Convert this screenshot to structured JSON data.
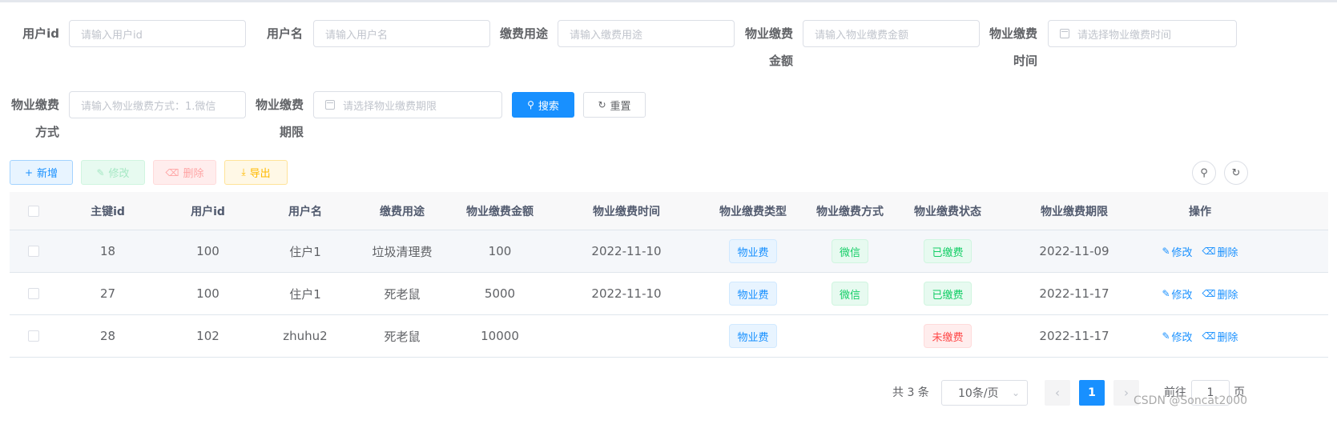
{
  "search": {
    "user_id": {
      "label": "用户id",
      "placeholder": "请输入用户id"
    },
    "user_name": {
      "label": "用户名",
      "placeholder": "请输入用户名"
    },
    "purpose": {
      "label": "缴费用途",
      "placeholder": "请输入缴费用途"
    },
    "amount": {
      "label_line1": "物业缴费",
      "label_line2": "金额",
      "placeholder": "请输入物业缴费金额"
    },
    "time": {
      "label_line1": "物业缴费",
      "label_line2": "时间",
      "placeholder": "请选择物业缴费时间"
    },
    "method": {
      "label_line1": "物业缴费",
      "label_line2": "方式",
      "placeholder": "请输入物业缴费方式：1.微信"
    },
    "deadline": {
      "label_line1": "物业缴费",
      "label_line2": "期限",
      "placeholder": "请选择物业缴费期限"
    },
    "search_button": "搜索",
    "reset_button": "重置"
  },
  "toolbar": {
    "add": "新增",
    "edit": "修改",
    "delete": "删除",
    "export": "导出"
  },
  "table": {
    "headers": [
      "主键id",
      "用户id",
      "用户名",
      "缴费用途",
      "物业缴费金额",
      "物业缴费时间",
      "物业缴费类型",
      "物业缴费方式",
      "物业缴费状态",
      "物业缴费期限",
      "操作"
    ],
    "edit_label": "修改",
    "delete_label": "删除",
    "rows": [
      {
        "id": "18",
        "user_id": "100",
        "user_name": "住户1",
        "purpose": "垃圾清理费",
        "amount": "100",
        "time": "2022-11-10",
        "type": "物业费",
        "method": "微信",
        "status": "已缴费",
        "deadline": "2022-11-09"
      },
      {
        "id": "27",
        "user_id": "100",
        "user_name": "住户1",
        "purpose": "死老鼠",
        "amount": "5000",
        "time": "2022-11-10",
        "type": "物业费",
        "method": "微信",
        "status": "已缴费",
        "deadline": "2022-11-17"
      },
      {
        "id": "28",
        "user_id": "102",
        "user_name": "zhuhu2",
        "purpose": "死老鼠",
        "amount": "10000",
        "time": "",
        "type": "物业费",
        "method": "",
        "status": "未缴费",
        "deadline": "2022-11-17"
      }
    ]
  },
  "pagination": {
    "total": "共 3 条",
    "page_size": "10条/页",
    "current_page": "1",
    "goto_prefix": "前往",
    "goto_value": "1",
    "goto_suffix": "页"
  },
  "watermark": "CSDN @Soncat2000",
  "colors": {
    "primary": "#1890ff",
    "success": "#13ce66",
    "danger": "#ff4949",
    "warning": "#ffba00"
  }
}
